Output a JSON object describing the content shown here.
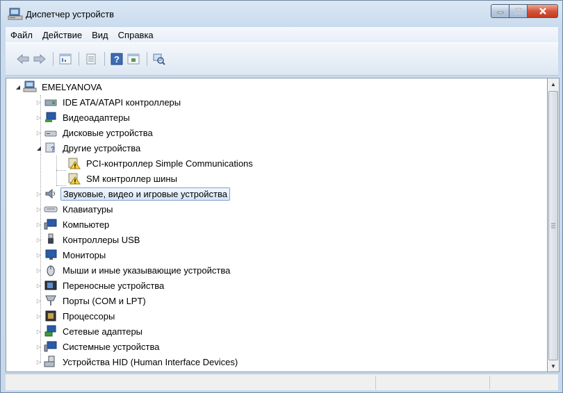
{
  "window": {
    "title": "Диспетчер устройств"
  },
  "menu": [
    "Файл",
    "Действие",
    "Вид",
    "Справка"
  ],
  "toolbar": {
    "buttons": [
      "back-arrow-icon",
      "forward-arrow-icon",
      "properties-icon",
      "view-icon",
      "help-icon",
      "update-driver-icon",
      "scan-hardware-icon"
    ]
  },
  "tree": {
    "root": "EMELYANOVA",
    "items": [
      {
        "label": "IDE ATA/ATAPI контроллеры",
        "icon": "ide-controller-icon"
      },
      {
        "label": "Видеоадаптеры",
        "icon": "video-adapter-icon"
      },
      {
        "label": "Дисковые устройства",
        "icon": "disk-drive-icon"
      },
      {
        "label": "Другие устройства",
        "icon": "other-devices-icon",
        "expanded": true,
        "children": [
          {
            "label": "PCI-контроллер Simple Communications",
            "icon": "unknown-device-warning-icon"
          },
          {
            "label": "SM контроллер шины",
            "icon": "unknown-device-warning-icon"
          }
        ]
      },
      {
        "label": "Звуковые, видео и игровые устройства",
        "icon": "sound-icon",
        "selected": true
      },
      {
        "label": "Клавиатуры",
        "icon": "keyboard-icon"
      },
      {
        "label": "Компьютер",
        "icon": "computer-icon"
      },
      {
        "label": "Контроллеры USB",
        "icon": "usb-controller-icon"
      },
      {
        "label": "Мониторы",
        "icon": "monitor-icon"
      },
      {
        "label": "Мыши и иные указывающие устройства",
        "icon": "mouse-icon"
      },
      {
        "label": "Переносные устройства",
        "icon": "portable-device-icon"
      },
      {
        "label": "Порты (COM и LPT)",
        "icon": "port-icon"
      },
      {
        "label": "Процессоры",
        "icon": "processor-icon"
      },
      {
        "label": "Сетевые адаптеры",
        "icon": "network-adapter-icon"
      },
      {
        "label": "Системные устройства",
        "icon": "system-device-icon"
      },
      {
        "label": "Устройства HID (Human Interface Devices)",
        "icon": "hid-device-icon"
      }
    ]
  }
}
